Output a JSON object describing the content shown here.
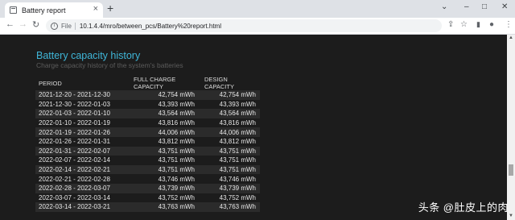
{
  "browser": {
    "tab_title": "Battery report",
    "tab_close": "×",
    "new_tab": "+",
    "window_controls": {
      "menu": "⌄",
      "minimize": "–",
      "maximize": "□",
      "close": "✕"
    },
    "nav": {
      "back": "←",
      "forward": "→",
      "reload": "↻"
    },
    "info_icon": "i",
    "scheme_label": "File",
    "url": "10.1.4.4/mro/between_pcs/Battery%20report.html",
    "toolbar_icons": {
      "share": "⇪",
      "bookmark": "☆",
      "side_panel": "▮",
      "profile": "●",
      "menu": "⋮"
    }
  },
  "page": {
    "title": "Battery capacity history",
    "subtitle": "Charge capacity history of the system's batteries",
    "table": {
      "headers": [
        "PERIOD",
        "FULL CHARGE CAPACITY",
        "DESIGN CAPACITY"
      ],
      "rows": [
        [
          "2021-12-20 - 2021-12-30",
          "42,754 mWh",
          "42,754 mWh"
        ],
        [
          "2021-12-30 - 2022-01-03",
          "43,393 mWh",
          "43,393 mWh"
        ],
        [
          "2022-01-03 - 2022-01-10",
          "43,564 mWh",
          "43,564 mWh"
        ],
        [
          "2022-01-10 - 2022-01-19",
          "43,816 mWh",
          "43,816 mWh"
        ],
        [
          "2022-01-19 - 2022-01-26",
          "44,006 mWh",
          "44,006 mWh"
        ],
        [
          "2022-01-26 - 2022-01-31",
          "43,812 mWh",
          "43,812 mWh"
        ],
        [
          "2022-01-31 - 2022-02-07",
          "43,751 mWh",
          "43,751 mWh"
        ],
        [
          "2022-02-07 - 2022-02-14",
          "43,751 mWh",
          "43,751 mWh"
        ],
        [
          "2022-02-14 - 2022-02-21",
          "43,751 mWh",
          "43,751 mWh"
        ],
        [
          "2022-02-21 - 2022-02-28",
          "43,746 mWh",
          "43,746 mWh"
        ],
        [
          "2022-02-28 - 2022-03-07",
          "43,739 mWh",
          "43,739 mWh"
        ],
        [
          "2022-03-07 - 2022-03-14",
          "43,752 mWh",
          "43,752 mWh"
        ],
        [
          "2022-03-14 - 2022-03-21",
          "43,763 mWh",
          "43,763 mWh"
        ]
      ]
    }
  },
  "watermark": "头条 @肚皮上的肉"
}
